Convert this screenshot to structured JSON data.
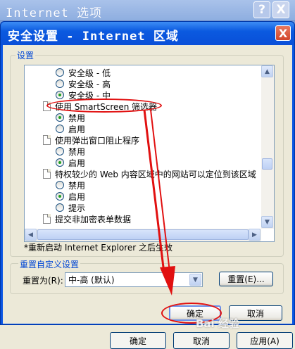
{
  "parent_window": {
    "title": "Internet 选项",
    "help_label": "?",
    "close_label": "X",
    "ok_label": "确定",
    "cancel_label": "取消",
    "apply_label": "应用(A)"
  },
  "dialog": {
    "title": "安全设置 - Internet 区域",
    "close_label": "X",
    "settings_group_label": "设置",
    "tree": [
      {
        "type": "radio",
        "label": "安全级 - 低",
        "checked": false
      },
      {
        "type": "radio",
        "label": "安全级 - 高",
        "checked": false
      },
      {
        "type": "radio",
        "label": "安全级 - 中",
        "checked": true
      },
      {
        "type": "category",
        "label": "使用 SmartScreen 筛选器"
      },
      {
        "type": "radio",
        "label": "禁用",
        "checked": true
      },
      {
        "type": "radio",
        "label": "启用",
        "checked": false
      },
      {
        "type": "category",
        "label": "使用弹出窗口阻止程序"
      },
      {
        "type": "radio",
        "label": "禁用",
        "checked": false
      },
      {
        "type": "radio",
        "label": "启用",
        "checked": true
      },
      {
        "type": "category",
        "label": "特权较少的 Web 内容区域中的网站可以定位到该区域"
      },
      {
        "type": "radio",
        "label": "禁用",
        "checked": false
      },
      {
        "type": "radio",
        "label": "启用",
        "checked": true
      },
      {
        "type": "radio",
        "label": "提示",
        "checked": false
      },
      {
        "type": "category",
        "label": "提交非加密表单数据"
      }
    ],
    "restart_note": "*重新启动 Internet Explorer 之后生效",
    "reset_group_label": "重置自定义设置",
    "reset_to_label": "重置为(R):",
    "reset_to_value": "中-高 (默认)",
    "reset_button_label": "重置(E)...",
    "ok_label": "确定",
    "cancel_label": "取消"
  },
  "watermark": "Bai 经验",
  "colors": {
    "title_bar": "#0a55e3",
    "dialog_face": "#ece9d8",
    "group_label": "#0046d5",
    "annotation": "#e11010",
    "radio_checked": "#21a121"
  },
  "icons": {
    "scroll_up": "triangle-up",
    "scroll_down": "triangle-down",
    "scroll_left": "triangle-left",
    "scroll_right": "triangle-right",
    "combo_arrow": "triangle-down"
  }
}
